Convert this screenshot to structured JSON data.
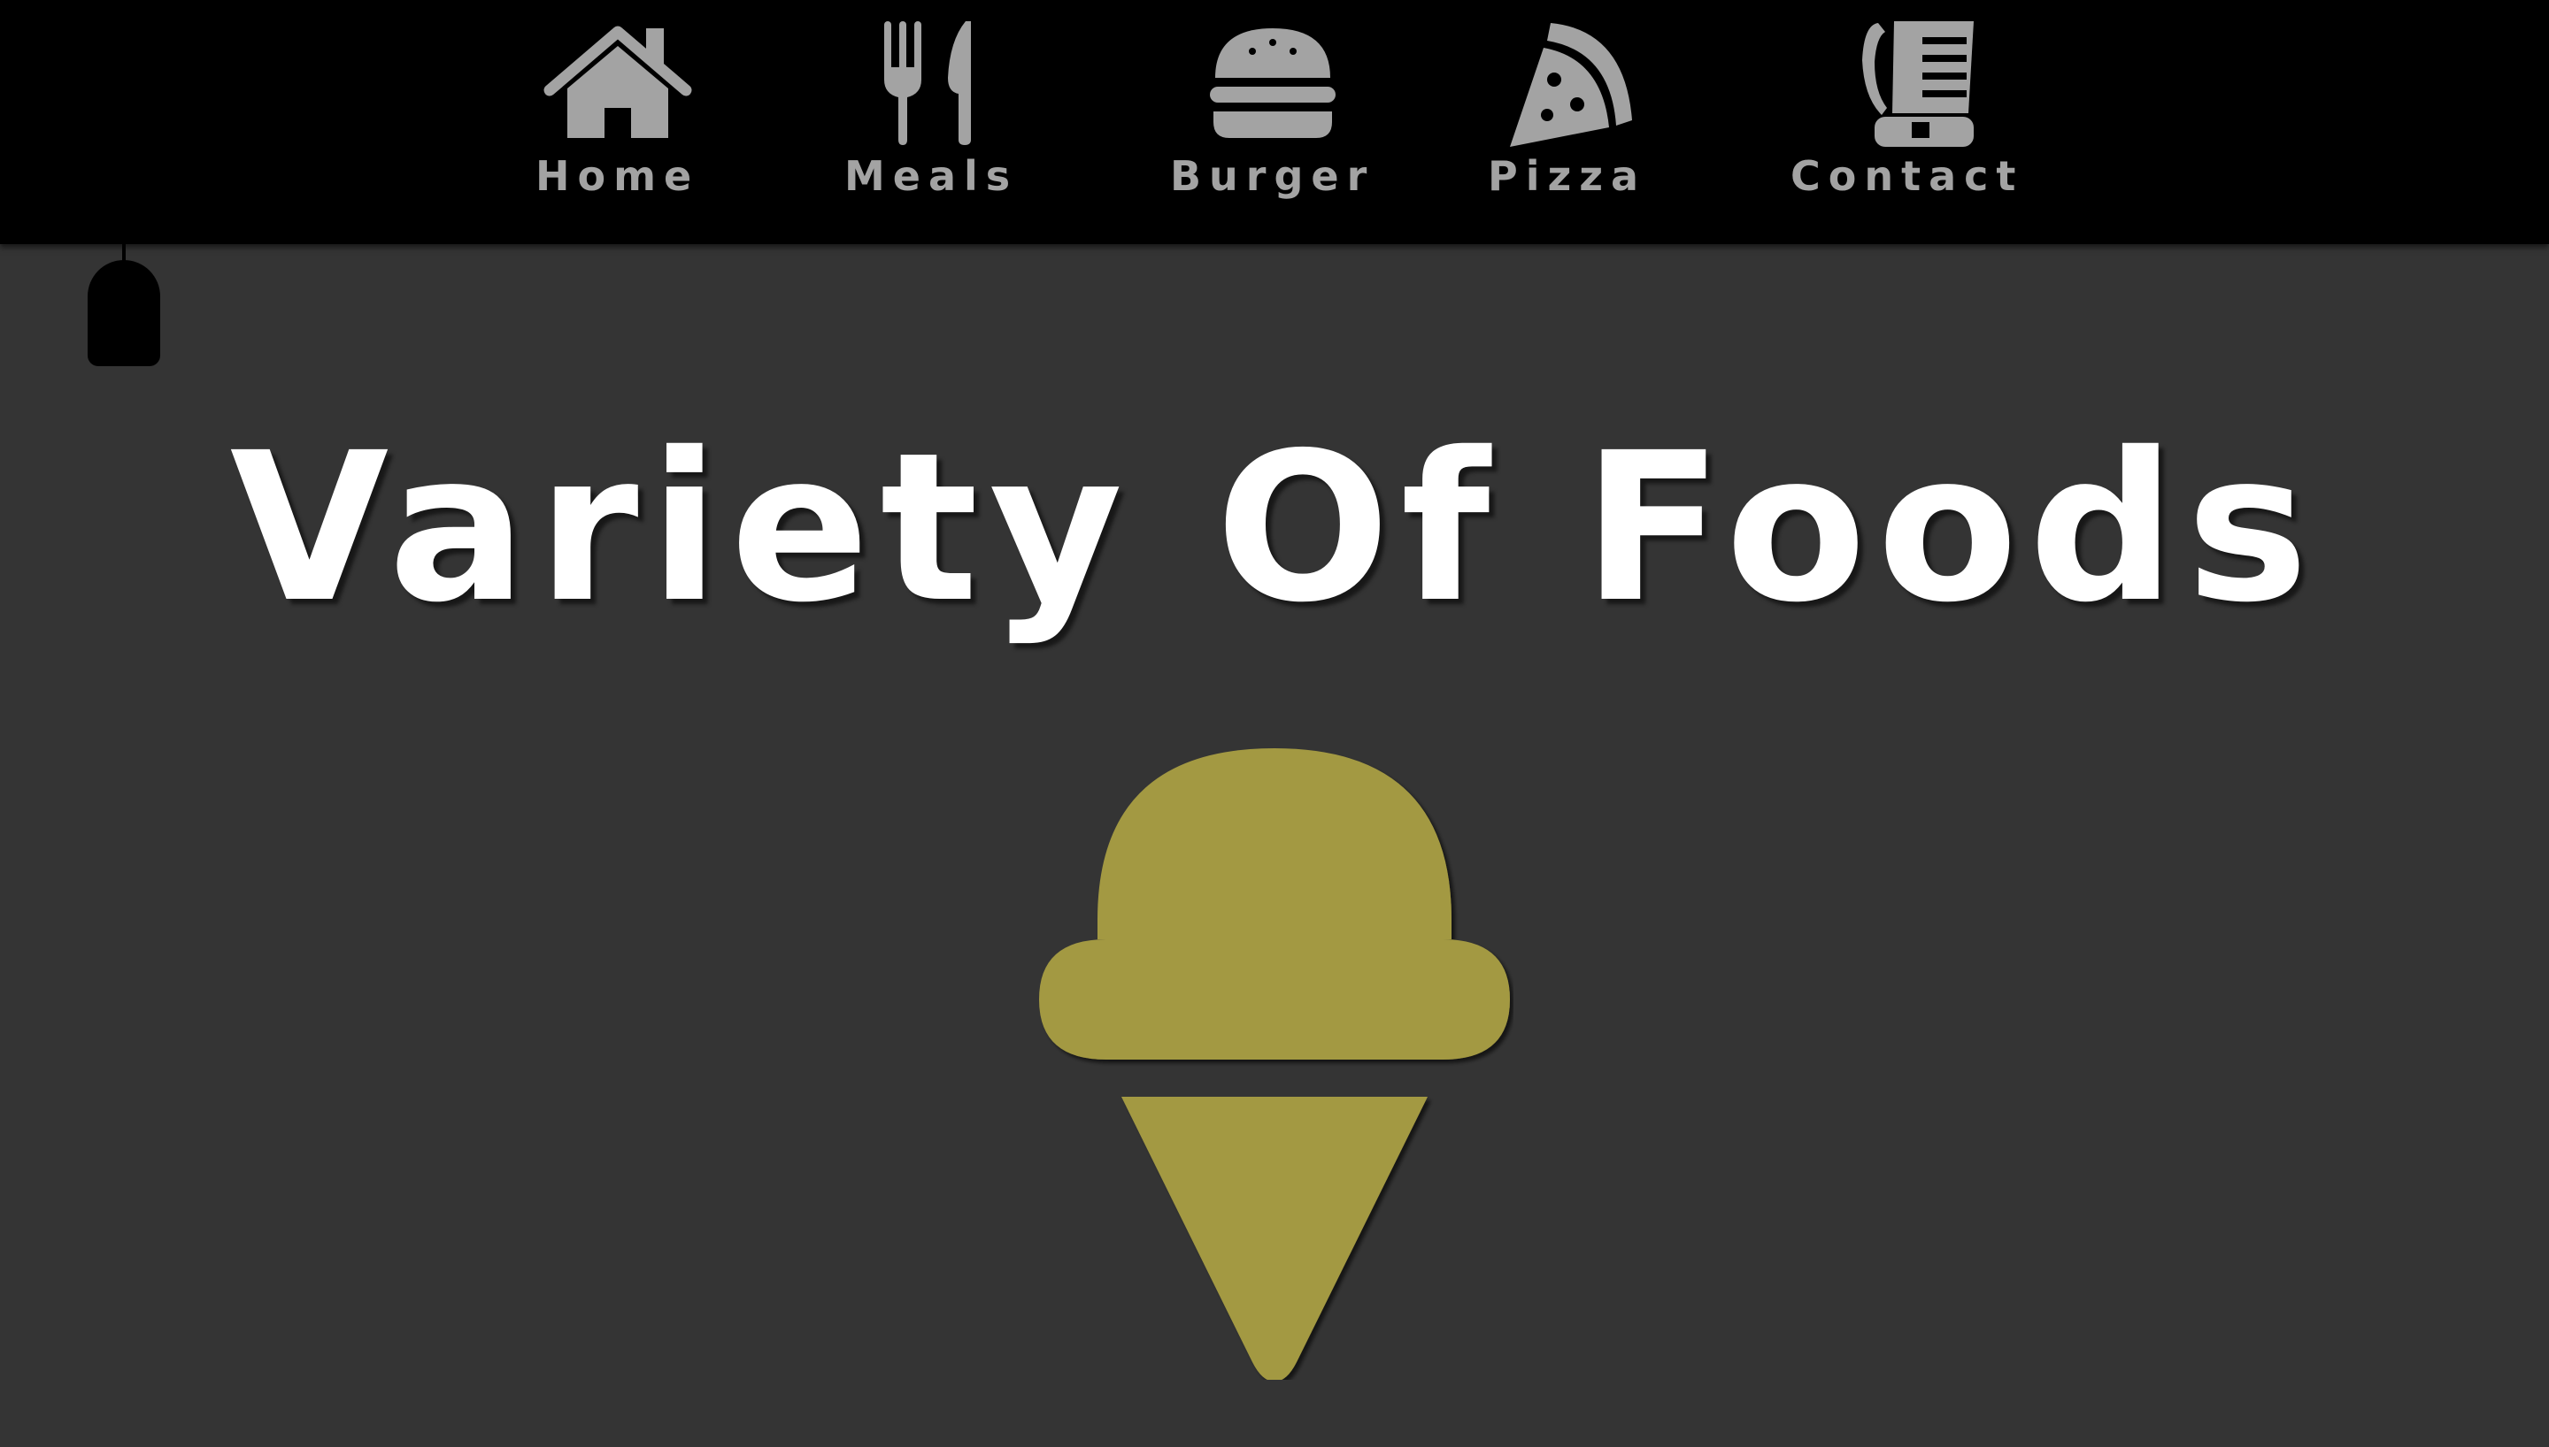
{
  "nav": {
    "items": [
      {
        "label": "Home",
        "icon": "house-icon"
      },
      {
        "label": "Meals",
        "icon": "fork-knife-icon"
      },
      {
        "label": "Burger",
        "icon": "burger-icon"
      },
      {
        "label": "Pizza",
        "icon": "pizza-slice-icon"
      },
      {
        "label": "Contact",
        "icon": "phone-book-icon"
      }
    ]
  },
  "hero": {
    "title": "Variety Of Foods",
    "icon": "ice-cream-icon"
  },
  "colors": {
    "page_background": "#343434",
    "navbar_background": "#000000",
    "nav_text": "#a3a3a3",
    "title_text": "#ffffff",
    "ice_cream": "#a39943"
  }
}
